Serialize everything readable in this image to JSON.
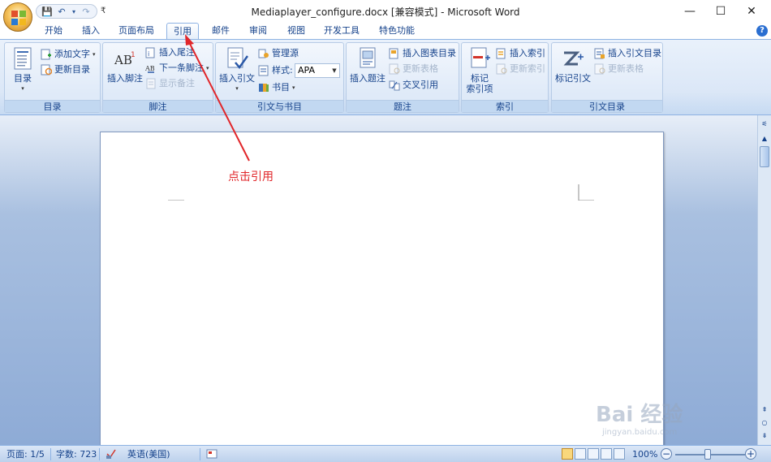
{
  "window": {
    "title": "Mediaplayer_configure.docx [兼容模式] - Microsoft Word",
    "minimize": "—",
    "maximize": "☐",
    "close": "✕"
  },
  "qat": {
    "save": "💾",
    "undo": "↶",
    "undo_caret": "▾",
    "redo": "↷",
    "customize": "₹"
  },
  "tabs": [
    "开始",
    "插入",
    "页面布局",
    "引用",
    "邮件",
    "审阅",
    "视图",
    "开发工具",
    "特色功能"
  ],
  "active_tab": "引用",
  "help": "?",
  "ribbon": {
    "toc": {
      "group_label": "目录",
      "big": "目录",
      "big_caret": "▾",
      "add_text": "添加文字",
      "add_text_caret": "▾",
      "update_toc": "更新目录"
    },
    "footnotes": {
      "group_label": "脚注",
      "big": "插入脚注",
      "insert_endnote": "插入尾注",
      "next_footnote": "下一条脚注",
      "next_caret": "▾",
      "show_notes": "显示备注"
    },
    "citations": {
      "group_label": "引文与书目",
      "big": "插入引文",
      "big_caret": "▾",
      "manage_sources": "管理源",
      "style_label": "样式:",
      "style_value": "APA",
      "bibliography": "书目",
      "bib_caret": "▾"
    },
    "captions": {
      "group_label": "题注",
      "big": "插入题注",
      "insert_table_of_figures": "插入图表目录",
      "update_table": "更新表格",
      "cross_reference": "交叉引用"
    },
    "index": {
      "group_label": "索引",
      "big_line1": "标记",
      "big_line2": "索引项",
      "insert_index": "插入索引",
      "update_index": "更新索引"
    },
    "toa": {
      "group_label": "引文目录",
      "big": "标记引文",
      "insert_toa": "插入引文目录",
      "update_table": "更新表格"
    }
  },
  "annotation": {
    "text": "点击引用",
    "color": "#e1262a"
  },
  "watermark": {
    "brand": "Bai 经验",
    "url": "jingyan.baidu.com"
  },
  "statusbar": {
    "page": "页面: 1/5",
    "words": "字数: 723",
    "language": "英语(美国)",
    "zoom": "100%",
    "zoom_minus": "−",
    "zoom_plus": "+"
  },
  "scrollbar": {
    "up": "▲",
    "down": "▼",
    "prev": "⇞",
    "browse": "○",
    "next": "⇟",
    "ruler": "⚟"
  },
  "colors": {
    "ribbon_text": "#15428b",
    "accent_border": "#8db2e3",
    "annotation_red": "#e1262a"
  }
}
